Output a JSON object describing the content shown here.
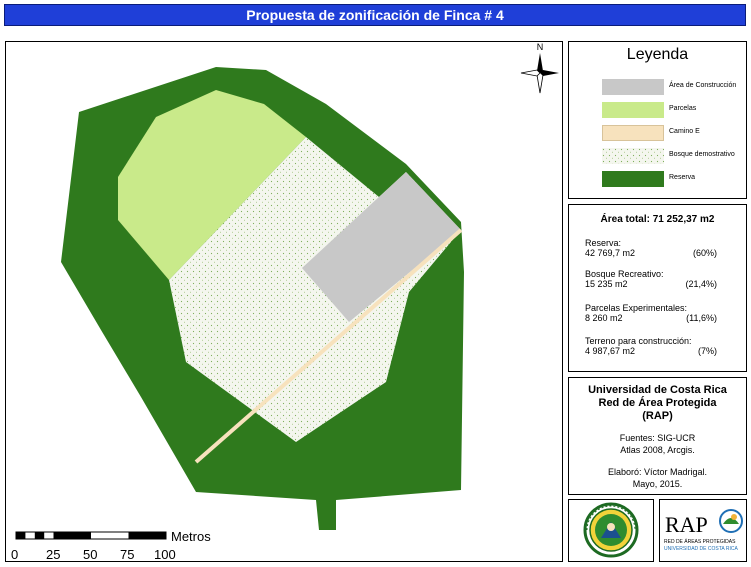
{
  "title": "Propuesta de zonificación de Finca # 4",
  "legend": {
    "title": "Leyenda",
    "items": [
      {
        "label": "Área de Construcción",
        "color": "#c8c8c8"
      },
      {
        "label": "Parcelas",
        "color": "#c9ea8a"
      },
      {
        "label": "Camino E",
        "color": "#f7e2bd"
      },
      {
        "label": "Bosque demostrativo",
        "color": "#f4f6ee"
      },
      {
        "label": "Reserva",
        "color": "#2f7a1d"
      }
    ]
  },
  "area": {
    "total": "Área total: 71 252,37 m2",
    "stats": [
      {
        "name": "Reserva:",
        "value": "42 769,7 m2",
        "pct": "(60%)"
      },
      {
        "name": "Bosque Recreativo:",
        "value": "15 235 m2",
        "pct": "(21,4%)"
      },
      {
        "name": "Parcelas Experimentales:",
        "value": "8 260 m2",
        "pct": "(11,6%)"
      },
      {
        "name": "Terreno para construcción:",
        "value": "4 987,67 m2",
        "pct": "(7%)"
      }
    ]
  },
  "credits": {
    "org1": "Universidad de Costa Rica",
    "org2": "Red de Área Protegida",
    "org3": "(RAP)",
    "fuentes": "Fuentes: SIG-UCR",
    "atlas": "Atlas 2008, Arcgis.",
    "elaboro": "Elaboró: Víctor Madrigal.",
    "fecha": "Mayo, 2015."
  },
  "north": "N",
  "scale": {
    "unit": "Metros",
    "ticks": [
      "0",
      "25",
      "50",
      "75",
      "100"
    ]
  },
  "rap_logo": {
    "mark": "RAP",
    "line1": "RED DE ÁREAS PROTEGIDAS",
    "line2": "UNIVERSIDAD DE COSTA RICA"
  },
  "colors": {
    "reserve": "#2f7a1d",
    "parcels": "#c9ea8a",
    "construction": "#c8c8c8",
    "road": "#f7e2bd",
    "forest": "#f4f6ee",
    "title_bar": "#1f3fd8"
  }
}
